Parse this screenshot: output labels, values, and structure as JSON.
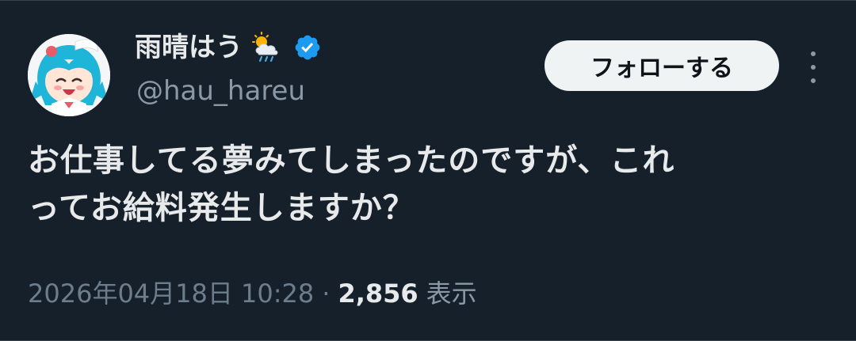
{
  "author": {
    "display_name": "雨晴はう",
    "handle": "@hau_hareu",
    "name_emoji": "sun-behind-rain-cloud",
    "verified_badge": "verified-icon"
  },
  "actions": {
    "follow_label": "フォローする",
    "more_icon": "more-vertical-icon"
  },
  "tweet": {
    "text_lines": [
      "お仕事してる夢みてしまったのですが、これ",
      "ってお給料発生しますか？"
    ]
  },
  "meta": {
    "timestamp": "2026年04月18日 10:28",
    "separator": "·",
    "views_count": "2,856",
    "views_label": "表示"
  },
  "colors": {
    "background": "#15202b",
    "primary_text": "#e7e9ea",
    "secondary_text": "#8b98a5",
    "verified_blue": "#1d9bf0",
    "follow_bg": "#eff3f4"
  }
}
